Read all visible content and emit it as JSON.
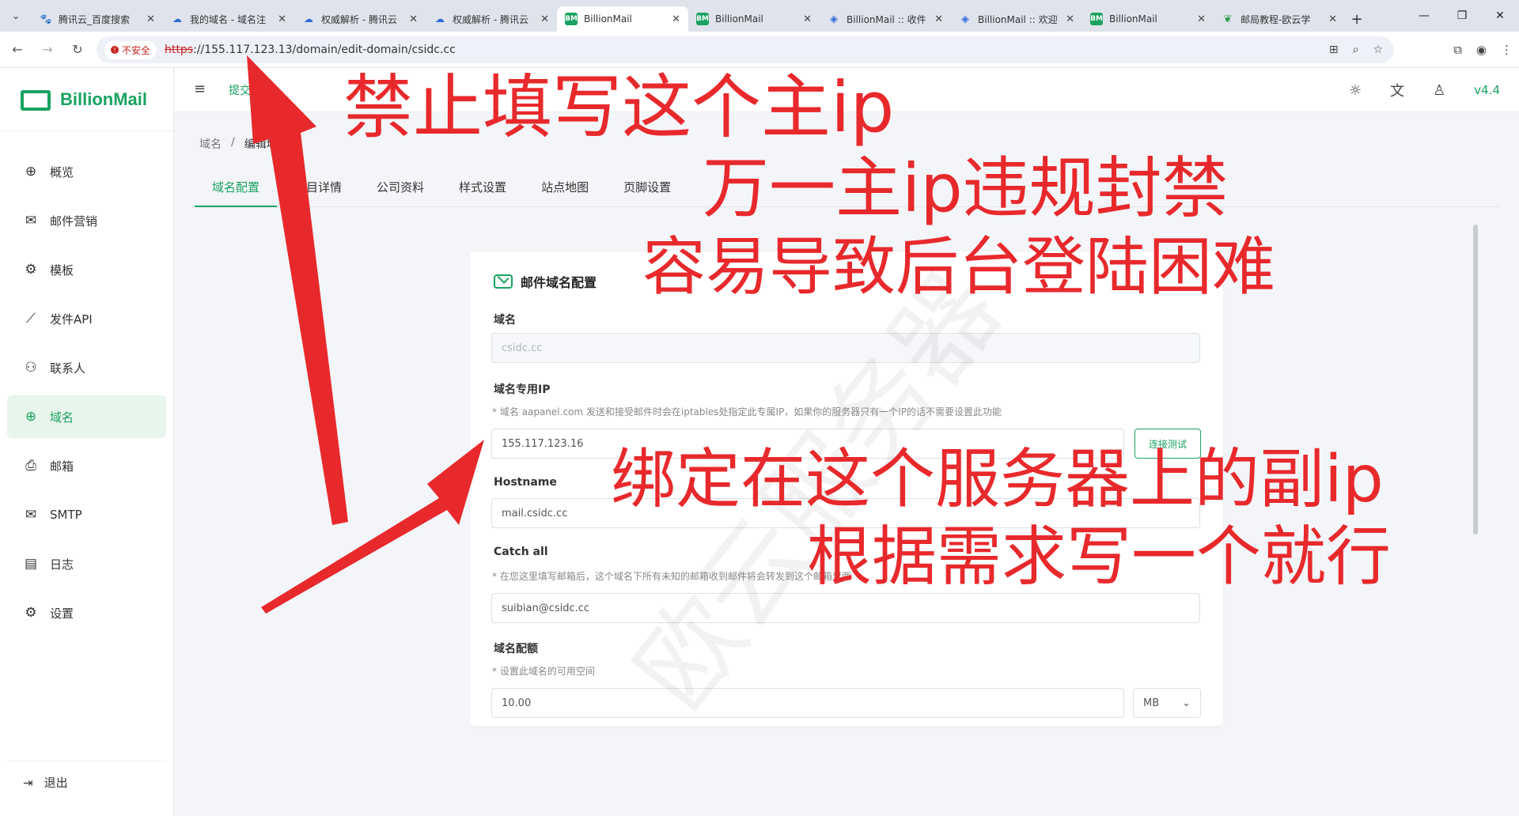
{
  "browser": {
    "tabs": [
      {
        "title": "腾讯云_百度搜索",
        "icon": "paw-icon",
        "active": false
      },
      {
        "title": "我的域名 - 域名注",
        "icon": "cloud-icon",
        "active": false
      },
      {
        "title": "权威解析 - 腾讯云",
        "icon": "cloud-icon",
        "active": false
      },
      {
        "title": "权威解析 - 腾讯云",
        "icon": "cloud-icon",
        "active": false
      },
      {
        "title": "BillionMail",
        "icon": "bm-icon",
        "active": true
      },
      {
        "title": "BillionMail",
        "icon": "bm-icon",
        "active": false
      },
      {
        "title": "BillionMail :: 收件",
        "icon": "hex-icon",
        "active": false
      },
      {
        "title": "BillionMail :: 欢迎",
        "icon": "hex-icon",
        "active": false
      },
      {
        "title": "BillionMail",
        "icon": "bm-icon",
        "active": false
      },
      {
        "title": "邮局教程-欧云学",
        "icon": "leaf-icon",
        "active": false
      }
    ],
    "insecure_label": "不安全",
    "url_scheme": "https",
    "url_rest": "://155.117.123.13/domain/edit-domain/csidc.cc"
  },
  "app": {
    "brand": "BillionMail",
    "nav": [
      {
        "label": "概览",
        "icon": "globe-icon"
      },
      {
        "label": "邮件营销",
        "icon": "mail-list-icon"
      },
      {
        "label": "模板",
        "icon": "gear-icon"
      },
      {
        "label": "发件API",
        "icon": "chart-icon"
      },
      {
        "label": "联系人",
        "icon": "contacts-icon"
      },
      {
        "label": "域名",
        "icon": "globe-icon",
        "active": true
      },
      {
        "label": "邮箱",
        "icon": "inbox-icon"
      },
      {
        "label": "SMTP",
        "icon": "smtp-icon"
      },
      {
        "label": "日志",
        "icon": "log-icon"
      },
      {
        "label": "设置",
        "icon": "gear-icon"
      }
    ],
    "logout": "退出",
    "header_hint": "提交… →",
    "version": "v4.4"
  },
  "page": {
    "breadcrumb": [
      "域名",
      "/",
      "编辑域名"
    ],
    "tabs": [
      "域名配置",
      "项目详情",
      "公司资料",
      "样式设置",
      "站点地图",
      "页脚设置"
    ],
    "card_title": "邮件域名配置",
    "fields": {
      "domain_label": "域名",
      "domain_value": "csidc.cc",
      "ip_label": "域名专用IP",
      "ip_desc": "* 域名 aapanel.com 发送和接受邮件时会在iptables处指定此专属IP，如果你的服务器只有一个IP的话不需要设置此功能",
      "ip_value": "155.117.123.16",
      "test_button": "连接测试",
      "hostname_label": "Hostname",
      "hostname_value": "mail.csidc.cc",
      "catchall_label": "Catch all",
      "catchall_desc": "* 在您这里填写邮箱后，这个域名下所有未知的邮箱收到邮件将会转发到这个邮箱里面",
      "catchall_value": "suibian@csidc.cc",
      "quota_label": "域名配额",
      "quota_desc": "* 设置此域名的可用空间",
      "quota_value": "10.00",
      "quota_unit": "MB"
    }
  },
  "annotations": {
    "note1": "禁止填写这个主ip",
    "note2": "万一主ip违规封禁",
    "note3": "容易导致后台登陆困难",
    "note4": "绑定在这个服务器上的副ip",
    "note5": "根据需求写一个就行",
    "watermark": "欧云服务器",
    "color": "#e8292c"
  }
}
